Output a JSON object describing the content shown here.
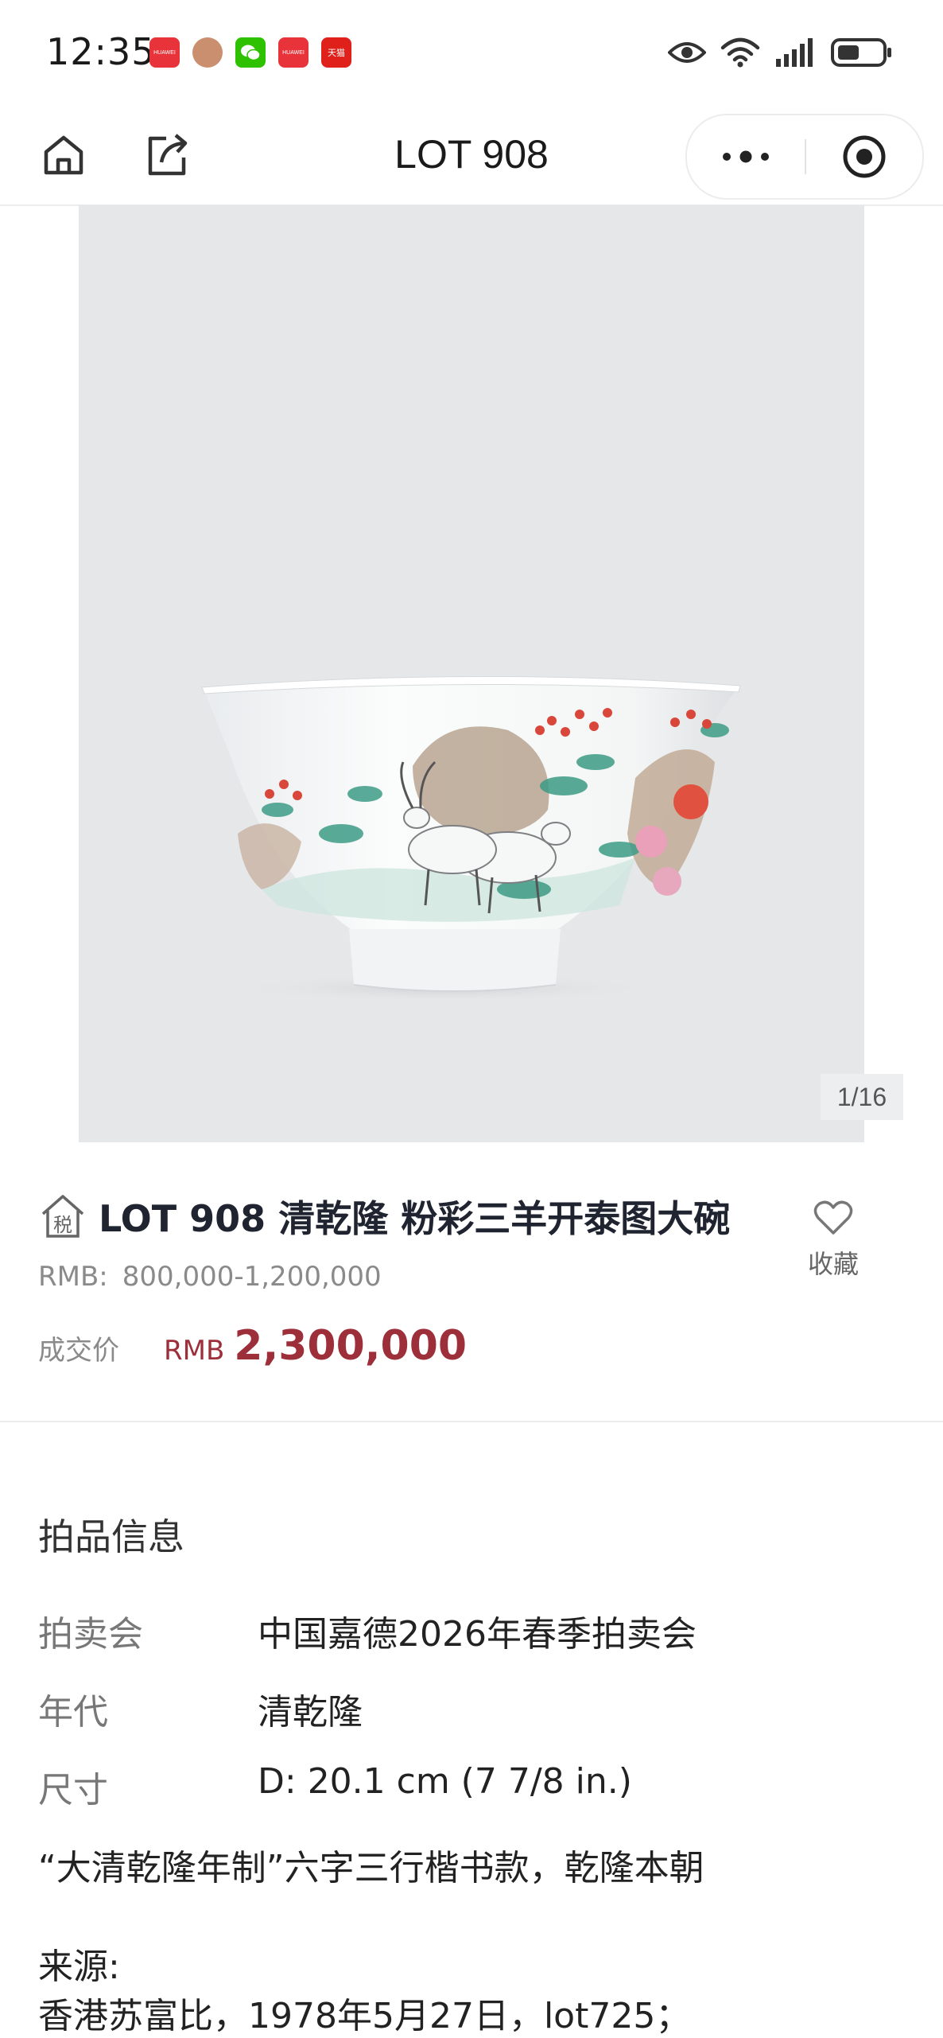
{
  "status_bar": {
    "time": "12:35",
    "notifications": [
      {
        "name": "huawei-store-notification",
        "label": "HUAWEI",
        "color": "#e8333b"
      },
      {
        "name": "avatar-notification",
        "label": "",
        "color": "#c98f6e"
      },
      {
        "name": "wechat-notification",
        "label": "",
        "color": "#2dc100"
      },
      {
        "name": "huawei-store-notification-2",
        "label": "HUAWEI",
        "color": "#e8333b"
      },
      {
        "name": "tmall-notification",
        "label": "天猫",
        "color": "#e0201b"
      }
    ],
    "icons": [
      "eye-icon",
      "wifi-icon",
      "signal-icon",
      "battery-icon"
    ]
  },
  "nav": {
    "title": "LOT 908",
    "icons": [
      "home-icon",
      "share-icon",
      "more-icon",
      "close-target-icon"
    ]
  },
  "gallery": {
    "counter": "1/16",
    "background": "#e6e7e9"
  },
  "lot": {
    "title": "LOT 908 清乾隆 粉彩三羊开泰图大碗",
    "tax_badge": "税",
    "estimate_label": "RMB:",
    "estimate_value": "800,000-1,200,000",
    "favorite_label": "收藏",
    "hammer_label": "成交价",
    "hammer_currency": "RMB",
    "hammer_price": "2,300,000",
    "price_color": "#9c2f3a"
  },
  "details": {
    "section_title": "拍品信息",
    "rows": [
      {
        "key": "拍卖会",
        "value": "中国嘉德2026年春季拍卖会"
      },
      {
        "key": "年代",
        "value": "清乾隆"
      },
      {
        "key": "尺寸",
        "value": "D: 20.1 cm (7 7/8 in.)"
      }
    ],
    "mark_note": "“大清乾隆年制”六字三行楷书款，乾隆本朝",
    "provenance_label": "来源:",
    "provenance_line": "香港苏富比，1978年5月27日，lot725；"
  }
}
